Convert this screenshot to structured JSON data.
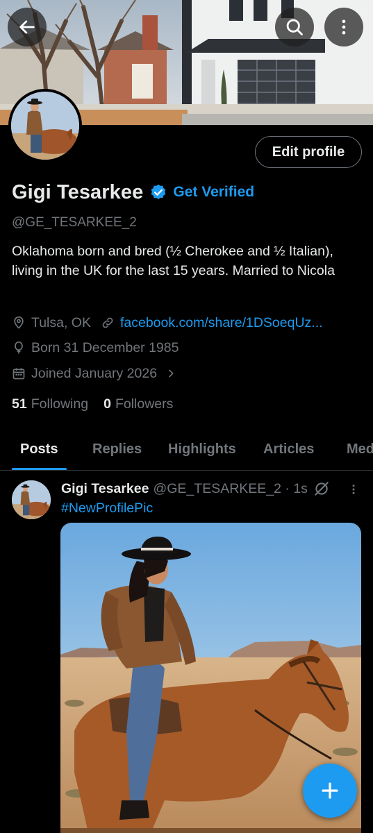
{
  "header": {
    "back_icon": "arrow-left-icon",
    "search_icon": "search-icon",
    "more_icon": "more-vertical-icon"
  },
  "profile": {
    "edit_button": "Edit profile",
    "name": "Gigi Tesarkee",
    "get_verified": "Get Verified",
    "handle": "@GE_TESARKEE_2",
    "bio": "Oklahoma born and bred (½ Cherokee and ½ Italian), living in the UK for the last 15 years. Married to Nicola",
    "location": "Tulsa, OK",
    "website": "facebook.com/share/1DSoeqUz...",
    "birthday": "Born 31 December 1985",
    "joined": "Joined January 2026",
    "following_count": "51",
    "following_label": "Following",
    "followers_count": "0",
    "followers_label": "Followers"
  },
  "tabs": [
    {
      "label": "Posts",
      "active": true
    },
    {
      "label": "Replies",
      "active": false
    },
    {
      "label": "Highlights",
      "active": false
    },
    {
      "label": "Articles",
      "active": false
    },
    {
      "label": "Media",
      "active": false
    }
  ],
  "post": {
    "author_name": "Gigi Tesarkee",
    "author_handle_time": "@GE_TESARKEE_2 · 1s",
    "text": "#NewProfilePic"
  },
  "colors": {
    "accent": "#1d9bf0",
    "background": "#000000",
    "secondary_text": "#71767b",
    "primary_text": "#e7e9ea"
  }
}
